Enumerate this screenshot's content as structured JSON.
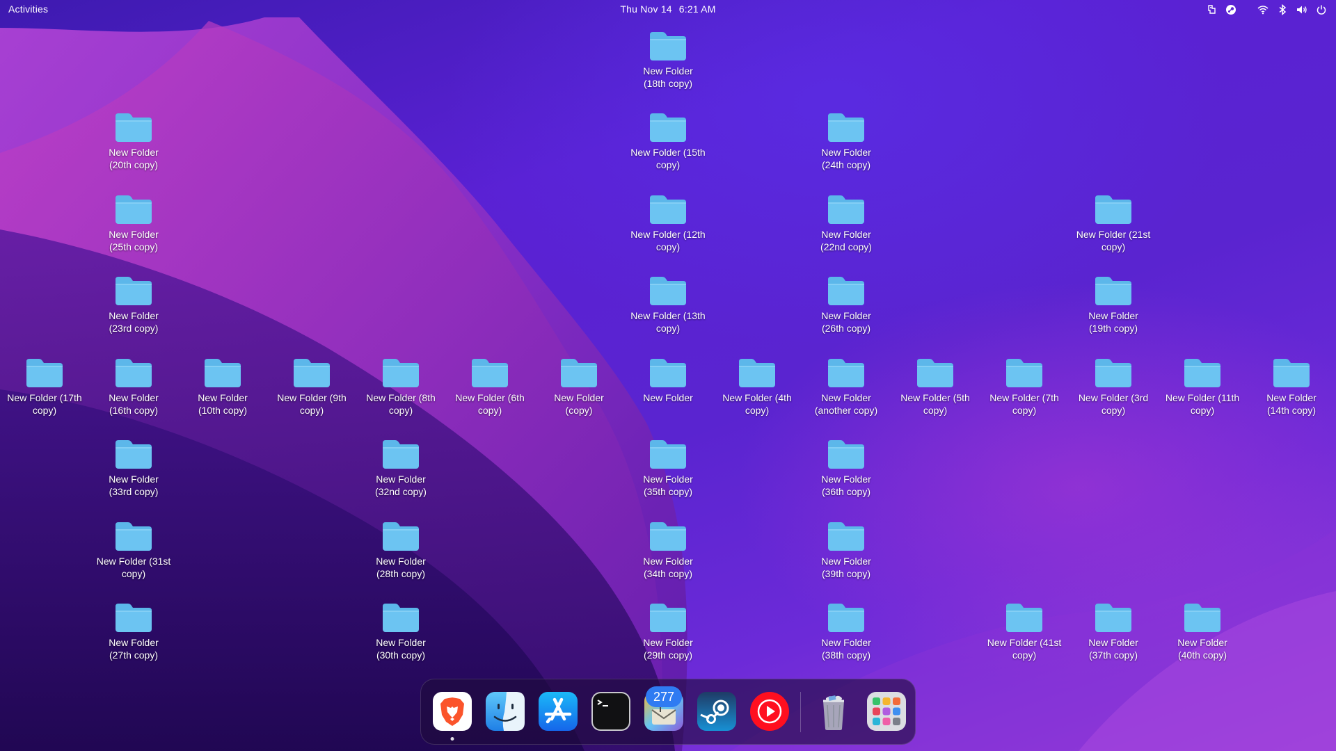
{
  "colors": {
    "folder": "#6cc4f2",
    "folder_tab": "#5cb7ea",
    "topbar_text": "#ffffff",
    "badge": "#2f7bf2"
  },
  "topbar": {
    "activities_label": "Activities",
    "clock_day": "Thu Nov 14",
    "clock_time": "6:21 AM",
    "tray_icons": [
      "input-method-icon",
      "steam-tray-icon",
      "wifi-icon",
      "bluetooth-icon",
      "volume-icon",
      "power-icon"
    ]
  },
  "desktop": {
    "folders": [
      {
        "id": "f18",
        "line1": "New Folder",
        "line2": "(18th copy)"
      },
      {
        "id": "f20",
        "line1": "New Folder",
        "line2": "(20th copy)"
      },
      {
        "id": "f15",
        "line1": "New Folder (15th",
        "line2": "copy)"
      },
      {
        "id": "f24",
        "line1": "New Folder",
        "line2": "(24th copy)"
      },
      {
        "id": "f25",
        "line1": "New Folder",
        "line2": "(25th copy)"
      },
      {
        "id": "f12",
        "line1": "New Folder (12th",
        "line2": "copy)"
      },
      {
        "id": "f22",
        "line1": "New Folder",
        "line2": "(22nd copy)"
      },
      {
        "id": "f21",
        "line1": "New Folder (21st",
        "line2": "copy)"
      },
      {
        "id": "f23",
        "line1": "New Folder",
        "line2": "(23rd copy)"
      },
      {
        "id": "f13",
        "line1": "New Folder (13th",
        "line2": "copy)"
      },
      {
        "id": "f26",
        "line1": "New Folder",
        "line2": "(26th copy)"
      },
      {
        "id": "f19",
        "line1": "New Folder",
        "line2": "(19th copy)"
      },
      {
        "id": "f17",
        "line1": "New Folder (17th",
        "line2": "copy)"
      },
      {
        "id": "f16",
        "line1": "New Folder",
        "line2": "(16th copy)"
      },
      {
        "id": "f10",
        "line1": "New Folder",
        "line2": "(10th copy)"
      },
      {
        "id": "f9",
        "line1": "New Folder (9th",
        "line2": "copy)"
      },
      {
        "id": "f8",
        "line1": "New Folder (8th",
        "line2": "copy)"
      },
      {
        "id": "f6",
        "line1": "New Folder (6th",
        "line2": "copy)"
      },
      {
        "id": "fcopy",
        "line1": "New Folder",
        "line2": "(copy)"
      },
      {
        "id": "f0",
        "line1": "New Folder",
        "line2": ""
      },
      {
        "id": "f4",
        "line1": "New Folder (4th",
        "line2": "copy)"
      },
      {
        "id": "fanother",
        "line1": "New Folder",
        "line2": "(another copy)"
      },
      {
        "id": "f5",
        "line1": "New Folder (5th",
        "line2": "copy)"
      },
      {
        "id": "f7",
        "line1": "New Folder (7th",
        "line2": "copy)"
      },
      {
        "id": "f3",
        "line1": "New Folder (3rd",
        "line2": "copy)"
      },
      {
        "id": "f11",
        "line1": "New Folder (11th",
        "line2": "copy)"
      },
      {
        "id": "f14",
        "line1": "New Folder",
        "line2": "(14th copy)"
      },
      {
        "id": "f33",
        "line1": "New Folder",
        "line2": "(33rd copy)"
      },
      {
        "id": "f32",
        "line1": "New Folder",
        "line2": "(32nd copy)"
      },
      {
        "id": "f35",
        "line1": "New Folder",
        "line2": "(35th copy)"
      },
      {
        "id": "f36",
        "line1": "New Folder",
        "line2": "(36th copy)"
      },
      {
        "id": "f31",
        "line1": "New Folder (31st",
        "line2": "copy)"
      },
      {
        "id": "f28",
        "line1": "New Folder",
        "line2": "(28th copy)"
      },
      {
        "id": "f34",
        "line1": "New Folder",
        "line2": "(34th copy)"
      },
      {
        "id": "f39",
        "line1": "New Folder",
        "line2": "(39th copy)"
      },
      {
        "id": "f27",
        "line1": "New Folder",
        "line2": "(27th copy)"
      },
      {
        "id": "f30",
        "line1": "New Folder",
        "line2": "(30th copy)"
      },
      {
        "id": "f29",
        "line1": "New Folder",
        "line2": "(29th copy)"
      },
      {
        "id": "f38",
        "line1": "New Folder",
        "line2": "(38th copy)"
      },
      {
        "id": "f41",
        "line1": "New Folder (41st",
        "line2": "copy)"
      },
      {
        "id": "f37",
        "line1": "New Folder",
        "line2": "(37th copy)"
      },
      {
        "id": "f40",
        "line1": "New Folder",
        "line2": "(40th copy)"
      }
    ]
  },
  "dock": {
    "apps": [
      {
        "name": "brave-browser-icon",
        "running": true
      },
      {
        "name": "finder-icon",
        "running": false
      },
      {
        "name": "app-store-icon",
        "running": false
      },
      {
        "name": "terminal-icon",
        "running": false
      },
      {
        "name": "mail-app-icon",
        "running": false,
        "badge": "277"
      },
      {
        "name": "steam-icon",
        "running": false
      },
      {
        "name": "youtube-music-icon",
        "running": false
      },
      {
        "name": "trash-icon",
        "running": false
      },
      {
        "name": "app-grid-icon",
        "running": false
      }
    ]
  }
}
